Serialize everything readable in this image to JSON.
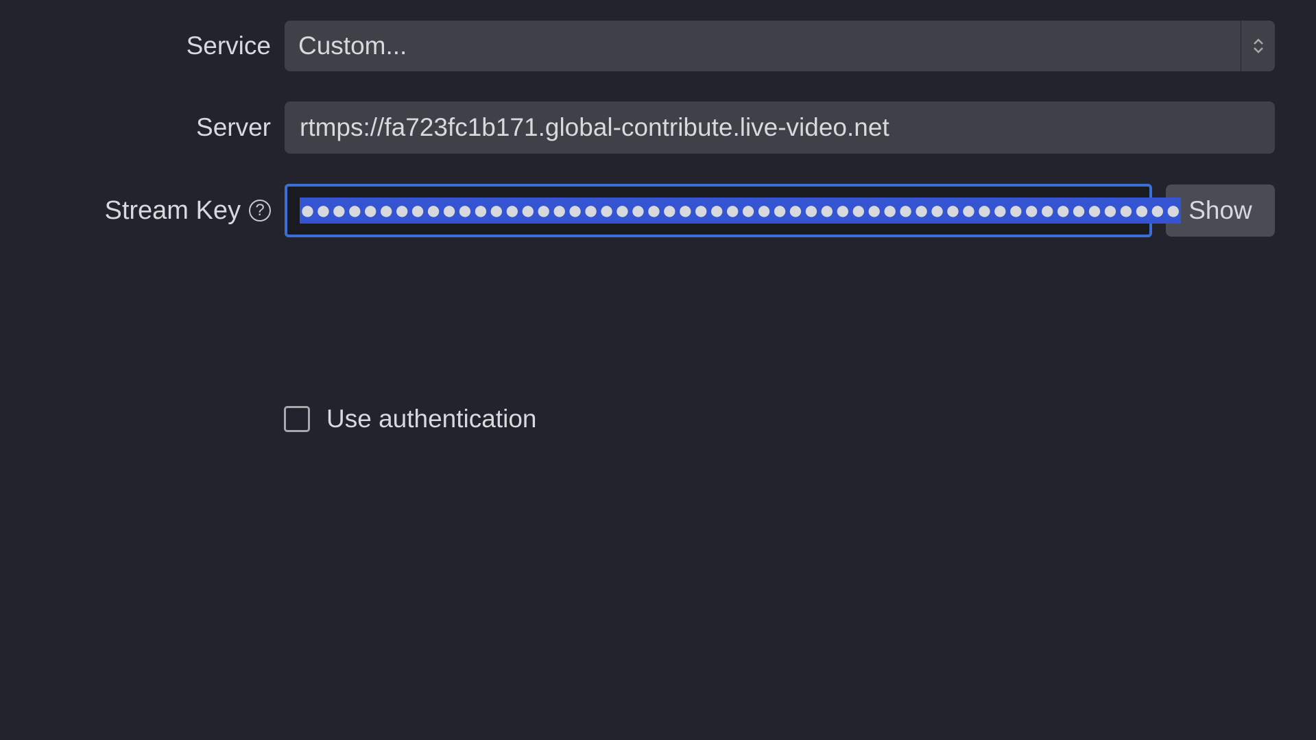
{
  "labels": {
    "service": "Service",
    "server": "Server",
    "streamKey": "Stream Key",
    "useAuthentication": "Use authentication"
  },
  "fields": {
    "serviceValue": "Custom...",
    "serverValue": "rtmps://fa723fc1b171.global-contribute.live-video.net",
    "streamKeyMasked": "●●●●●●●●●●●●●●●●●●●●●●●●●●●●●●●●●●●●●●●●●●●●●●●●●●●●●●●●"
  },
  "buttons": {
    "show": "Show"
  },
  "help": {
    "symbol": "?"
  }
}
